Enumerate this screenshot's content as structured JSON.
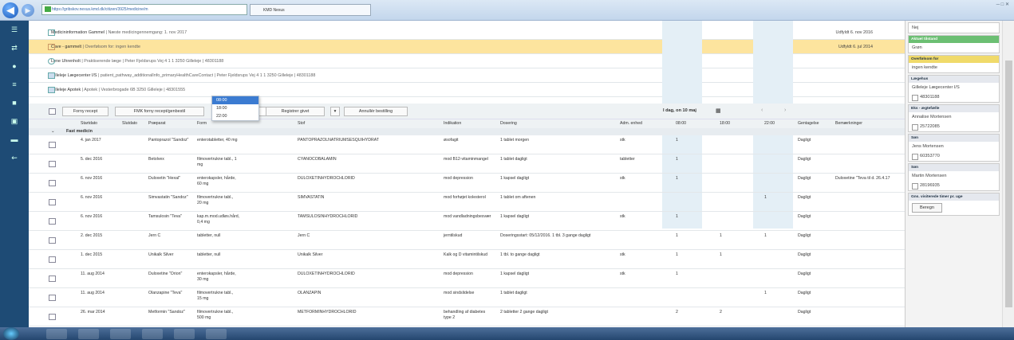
{
  "browser": {
    "url": "https://gribskov.nexus.kmd.dk/citizen/3925/medicine/m",
    "tab_title": "KMD Nexus"
  },
  "info_lines": [
    {
      "title": "Medicininformation Gammel",
      "detail": "| Næste medicingennemgang: 1. nov 2017",
      "date": "Udfyldt 6. nov 2016",
      "highlight": false
    },
    {
      "title": "Cave - gammelt",
      "detail": "| Overfølsom for: ingen kendte",
      "date": "Udfyldt 6. jul 2014",
      "highlight": true
    },
    {
      "title": "Lene Uhrenholt",
      "detail": "| Praktiserende læge | Peter Fjeldsrups Vej 4 1 1 3250 Gilleleje | 48301188",
      "date": "",
      "highlight": false
    },
    {
      "title": "Gilleleje Lægecenter I/S",
      "detail": "| patient_pathway_additionalInfo_primaryHealthCareContact | Peter Fjeldsrups Vej 4 1 1 3250 Gilleleje | 48301188",
      "date": "",
      "highlight": false
    },
    {
      "title": "Gilleleje Apotek",
      "detail": "| Apotek | Vesterbrogade 6B 3250 Gilleleje | 48301555",
      "date": "",
      "highlight": false
    }
  ],
  "toolbar": {
    "forny": "Forny recept",
    "fmk": "FMK forny recept/genbestil",
    "registrer": "Registrer givet",
    "annuller": "Annullér bestilling",
    "day": "I dag, on 10 maj"
  },
  "time_dropdown": [
    "08:00",
    "18:00",
    "22:00"
  ],
  "headers": {
    "start": "Startdato",
    "slut": "Slutdato",
    "praeparat": "Præparat",
    "form": "Form",
    "stof": "Stof",
    "indikation": "Indikation",
    "dosering": "Dosering",
    "adm": "Adm. enhed",
    "t1": "08:00",
    "t2": "18:00",
    "t3": "22:00",
    "gentagelse": "Gentagelse",
    "bem": "Bemærkninger"
  },
  "group": "Fast medicin",
  "rows": [
    {
      "start": "4. jan 2017",
      "prep": "Pantoprazol \"Sandoz\"",
      "form": "enterotabletter, 40 mg",
      "stof": "PANTOPRAZOLNATRIUMSESQUIHYDRAT",
      "ind": "øsofagit",
      "dos": "1 tablet morgen",
      "adm": "stk",
      "d1": "1",
      "d2": "",
      "d3": "",
      "rep": "Dagligt",
      "note": ""
    },
    {
      "start": "5. dec 2016",
      "prep": "Betolvex",
      "form": "filmovertrukne tabl., 1 mg",
      "stof": "CYANOCOBALAMIN",
      "ind": "mod B12-vitaminmangel",
      "dos": "1 tablet dagligt",
      "adm": "tabletter",
      "d1": "1",
      "d2": "",
      "d3": "",
      "rep": "Dagligt",
      "note": ""
    },
    {
      "start": "6. nov 2016",
      "prep": "Duloxetin \"Hexal\"",
      "form": "enterokapsler, hårde, 60 mg",
      "stof": "DULOXETINHYDROCHLORID",
      "ind": "mod depression",
      "dos": "1 kapsel dagligt",
      "adm": "stk",
      "d1": "1",
      "d2": "",
      "d3": "",
      "rep": "Dagligt",
      "note": "Duloxetine \"Teva til d. 26.4.17"
    },
    {
      "start": "6. nov 2016",
      "prep": "Simvastatin \"Sandoz\"",
      "form": "filmovertrukne tabl., 20 mg",
      "stof": "SIMVASTATIN",
      "ind": "mod forhøjet kolesterol",
      "dos": "1 tablet om aftenen",
      "adm": "",
      "d1": "",
      "d2": "",
      "d3": "1",
      "rep": "Dagligt",
      "note": ""
    },
    {
      "start": "6. nov 2016",
      "prep": "Tamsulosin \"Teva\"",
      "form": "kap.m.mod.udløs.hård, 0,4 mg",
      "stof": "TAMSULOSINHYDROCHLORID",
      "ind": "mod vandladningsbesvær",
      "dos": "1 kapsel dagligt",
      "adm": "stk",
      "d1": "1",
      "d2": "",
      "d3": "",
      "rep": "Dagligt",
      "note": ""
    },
    {
      "start": "2. dec 2015",
      "prep": "Jern C",
      "form": "tabletter, null",
      "stof": "Jern C",
      "ind": "jerntilskud",
      "dos": "Doseringsstart: 05/12/2016. 1 tbl. 3 gange dagligt",
      "adm": "",
      "d1": "1",
      "d2": "1",
      "d3": "1",
      "rep": "Dagligt",
      "note": ""
    },
    {
      "start": "1. dec 2015",
      "prep": "Unikalk Silver",
      "form": "tabletter, null",
      "stof": "Unikalk Silver",
      "ind": "Kalk og D vitamintilskud",
      "dos": "1 tbl. to gange dagligt",
      "adm": "stk",
      "d1": "1",
      "d2": "1",
      "d3": "",
      "rep": "Dagligt",
      "note": ""
    },
    {
      "start": "11. aug 2014",
      "prep": "Duloxetine \"Orion\"",
      "form": "enterokapsler, hårde, 30 mg",
      "stof": "DULOXETINHYDROCHLORID",
      "ind": "mod depression",
      "dos": "1 kapsel dagligt",
      "adm": "stk",
      "d1": "1",
      "d2": "",
      "d3": "",
      "rep": "Dagligt",
      "note": ""
    },
    {
      "start": "11. aug 2014",
      "prep": "Olanzapine \"Teva\"",
      "form": "filmovertrukne tabl., 15 mg",
      "stof": "OLANZAPIN",
      "ind": "mod sindslidelse",
      "dos": "1 tablet dagligt",
      "adm": "",
      "d1": "",
      "d2": "",
      "d3": "1",
      "rep": "Dagligt",
      "note": ""
    },
    {
      "start": "26. mar 2014",
      "prep": "Metformin \"Sandoz\"",
      "form": "filmovertrukne tabl., 500 mg",
      "stof": "METFORMINHYDROCHLORID",
      "ind": "behandling af diabetes type 2",
      "dos": "2 tabletter 2 gange dagligt",
      "adm": "",
      "d1": "2",
      "d2": "2",
      "d3": "",
      "rep": "Dagligt",
      "note": ""
    }
  ],
  "sidebar": {
    "top_value": "Nej",
    "aktuel_label": "Aktuel tilstand",
    "aktuel_value": "Grøn",
    "overfolsom_label": "Overfølsom for",
    "overfolsom_value": "ingen kendte",
    "laege_label": "Lægehus",
    "laege_name": "Gilleleje Lægecenter I/S",
    "laege_phone": "48301188",
    "aegtefaelle_label": "Eks - ægtefælle",
    "aegtefaelle_name": "Annalise Mortensen",
    "aegtefaelle_phone": "25722085",
    "son1_label": "Søn",
    "son1_name": "Jens Mortensen",
    "son1_phone": "60353770",
    "son2_label": "Søn",
    "son2_name": "Martin Mortensen",
    "son2_phone": "28196935",
    "timer_label": "Gns. visiterede timer pr. uge",
    "beregn": "Beregn"
  },
  "colors": {
    "nav": "#1e4b75",
    "highlight": "#fde49e",
    "accent": "#3b7bd1",
    "green": "#6cbf73"
  }
}
